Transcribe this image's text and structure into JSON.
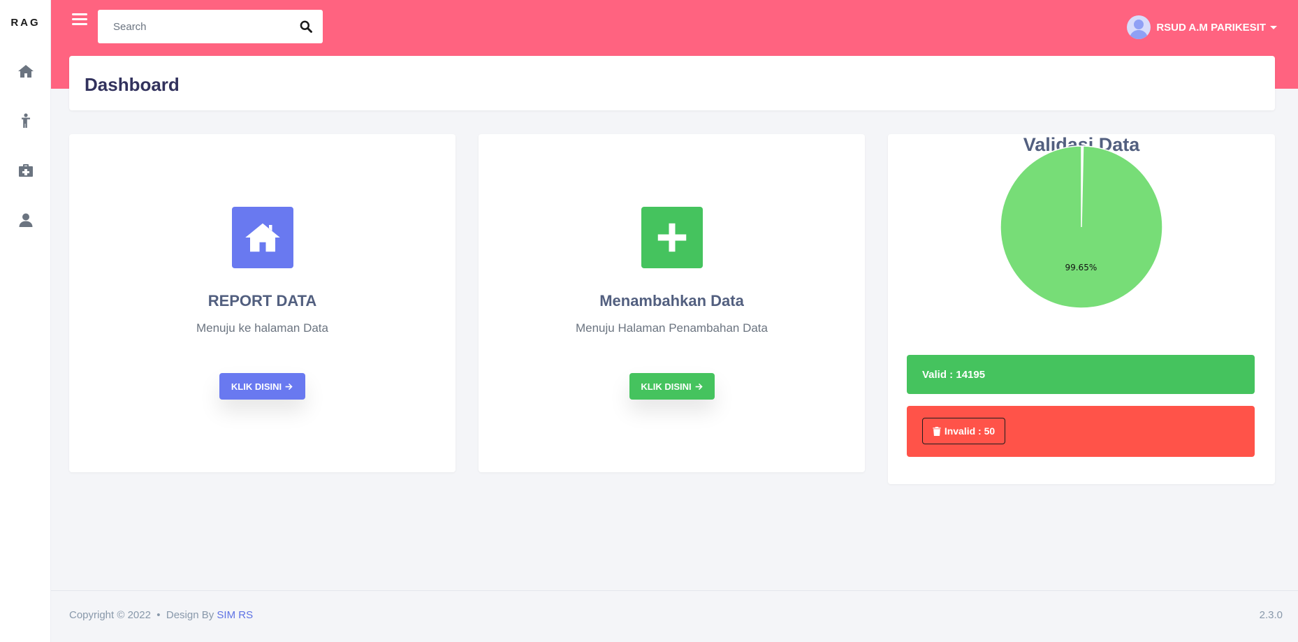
{
  "sidebar": {
    "brand": "RAG",
    "items": [
      {
        "icon": "home-icon"
      },
      {
        "icon": "person-icon"
      },
      {
        "icon": "medkit-icon"
      },
      {
        "icon": "user-icon"
      }
    ]
  },
  "topbar": {
    "search_placeholder": "Search",
    "user_name": "RSUD A.M PARIKESIT"
  },
  "page": {
    "title": "Dashboard"
  },
  "cards": [
    {
      "title": "REPORT DATA",
      "subtitle": "Menuju ke halaman Data",
      "button": "KLIK DISINI",
      "color": "#6979f0",
      "icon": "home-icon"
    },
    {
      "title": "Menambahkan Data",
      "subtitle": "Menuju Halaman Penambahan Data",
      "button": "KLIK DISINI",
      "color": "#45c35e",
      "icon": "plus-icon"
    }
  ],
  "validation": {
    "title": "Validasi Data",
    "valid_label": "Valid : 14195",
    "invalid_label": "Invalid : 50"
  },
  "chart_data": {
    "type": "pie",
    "title": "Validasi Data",
    "slices": [
      {
        "label": "Invalid",
        "value": 50,
        "percent_label": "0.35%",
        "color": "#ffffff"
      },
      {
        "label": "Valid",
        "value": 14195,
        "percent_label": "99.65%",
        "color": "#77dd77"
      }
    ]
  },
  "footer": {
    "copyright": "Copyright © 2022  •  Design By ",
    "link": "SIM RS",
    "version": "2.3.0"
  },
  "colors": {
    "topbar": "#ff6380",
    "report": "#6979f0",
    "add": "#45c35e",
    "valid": "#45c35e",
    "invalid": "#ff5349"
  }
}
